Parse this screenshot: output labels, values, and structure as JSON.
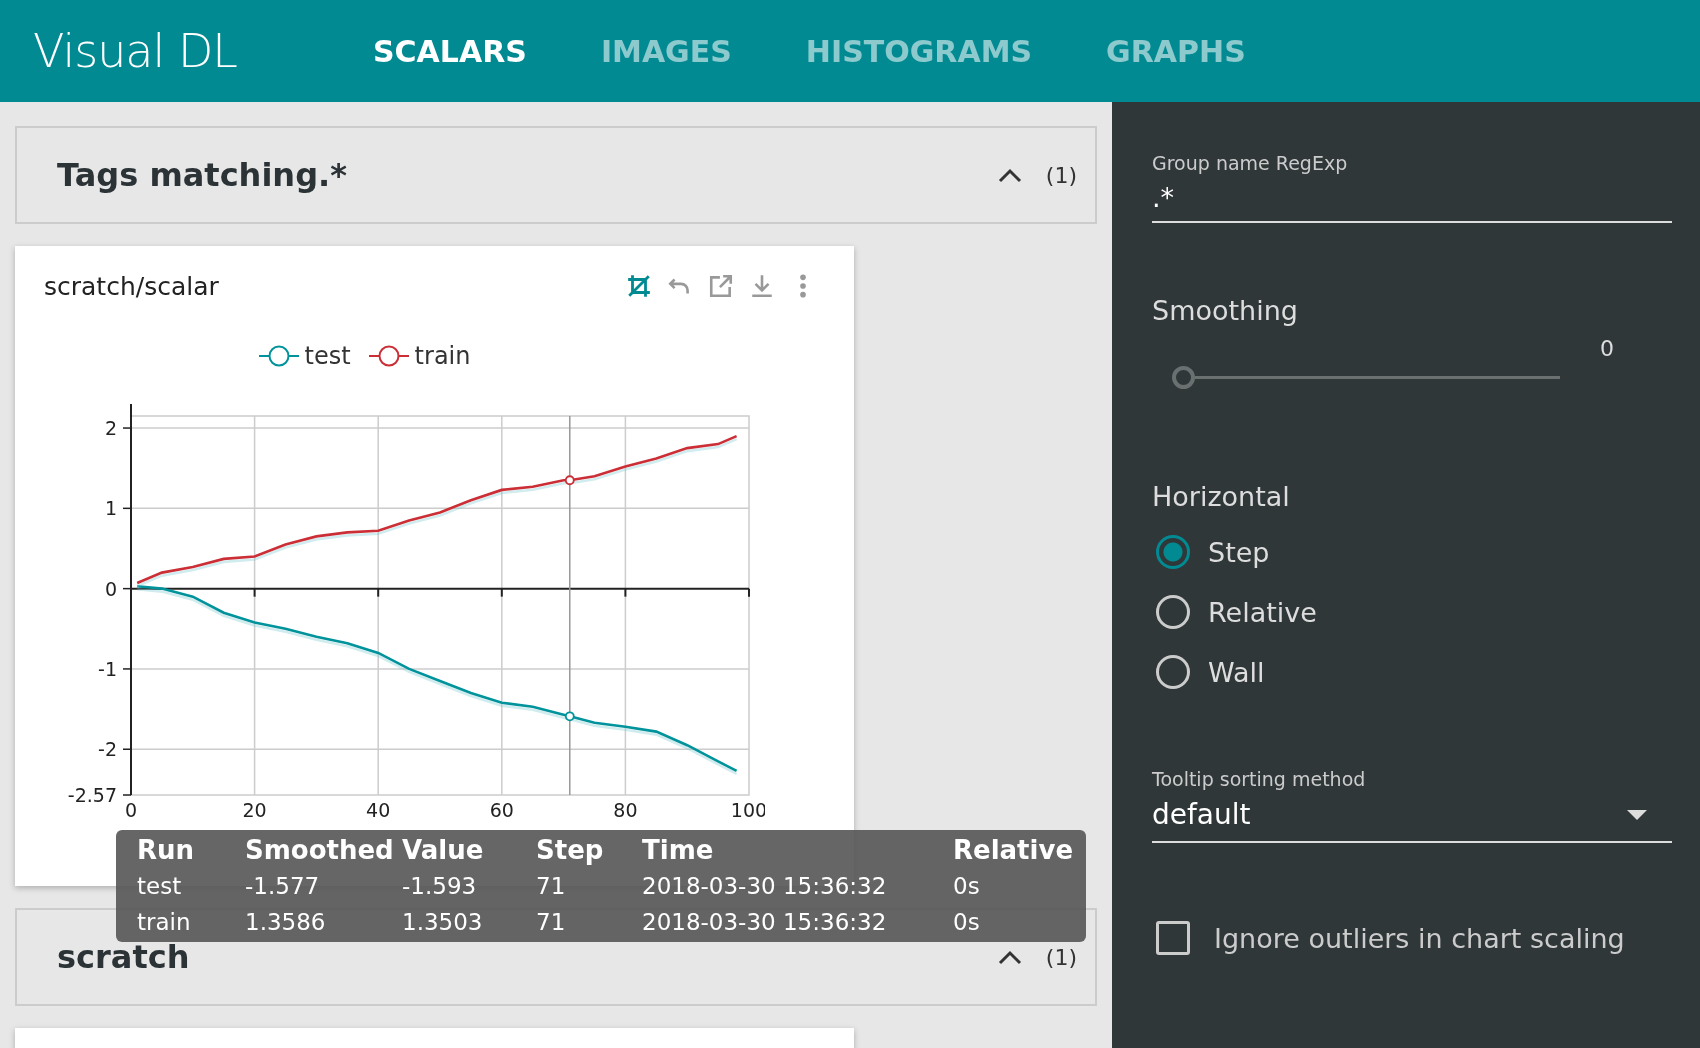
{
  "header": {
    "logo": "Visual DL",
    "tabs": [
      {
        "label": "SCALARS",
        "selected": true
      },
      {
        "label": "IMAGES",
        "selected": false
      },
      {
        "label": "HISTOGRAMS",
        "selected": false
      },
      {
        "label": "GRAPHS",
        "selected": false
      }
    ]
  },
  "groups": [
    {
      "title": "Tags matching.*",
      "expanded": true,
      "count": "(1)",
      "cards": [
        {
          "kind": "chart",
          "title": "scratch/scalar",
          "toolbar": [
            {
              "kind": "crop",
              "selected": true
            },
            {
              "kind": "undo",
              "selected": false
            },
            {
              "kind": "expand",
              "selected": false
            },
            {
              "kind": "download",
              "selected": false
            },
            {
              "kind": "more",
              "selected": false
            }
          ],
          "chart_data": {
            "type": "line",
            "x": [
              1,
              5,
              10,
              15,
              20,
              25,
              30,
              35,
              40,
              45,
              50,
              55,
              60,
              65,
              70,
              71,
              75,
              80,
              85,
              90,
              95,
              98
            ],
            "series": [
              {
                "name": "test",
                "color": "#00939c",
                "values": [
                  0.03,
                  0.0,
                  -0.1,
                  -0.3,
                  -0.42,
                  -0.5,
                  -0.6,
                  -0.68,
                  -0.8,
                  -1.0,
                  -1.15,
                  -1.3,
                  -1.42,
                  -1.47,
                  -1.57,
                  -1.59,
                  -1.67,
                  -1.72,
                  -1.78,
                  -1.95,
                  -2.15,
                  -2.27
                ]
              },
              {
                "name": "train",
                "color": "#cc2e36",
                "values": [
                  0.07,
                  0.2,
                  0.27,
                  0.37,
                  0.4,
                  0.55,
                  0.65,
                  0.7,
                  0.72,
                  0.85,
                  0.95,
                  1.1,
                  1.23,
                  1.27,
                  1.35,
                  1.35,
                  1.4,
                  1.52,
                  1.62,
                  1.75,
                  1.8,
                  1.9
                ]
              }
            ],
            "xlim": [
              0,
              100
            ],
            "ylim": [
              -2.57,
              2.15
            ],
            "xticks": [
              0,
              20,
              40,
              60,
              80,
              100
            ],
            "yticks": [
              -2.57,
              -2,
              -1,
              0,
              1,
              2
            ],
            "grid": true,
            "legend": "top",
            "ref_lines": [
              {
                "axis": "x",
                "value": 71
              }
            ]
          }
        }
      ]
    },
    {
      "title": "scratch",
      "expanded": true,
      "count": "(1)",
      "cards": [
        {
          "kind": "cut_off"
        }
      ]
    }
  ],
  "tooltip": {
    "columns": [
      "Run",
      "Smoothed",
      "Value",
      "Step",
      "Time",
      "Relative"
    ],
    "rows": [
      [
        "test",
        "-1.577",
        "-1.593",
        "71",
        "2018-03-30 15:36:32",
        "0s"
      ],
      [
        "train",
        "1.3586",
        "1.3503",
        "71",
        "2018-03-30 15:36:32",
        "0s"
      ]
    ]
  },
  "settings": {
    "regexp": {
      "label": "Group name RegExp",
      "value": ".*"
    },
    "smoothing": {
      "label": "Smoothing",
      "reading": "0",
      "level": 0
    },
    "horizontal": {
      "label": "Horizontal",
      "options": [
        {
          "label": "Step",
          "selected": true
        },
        {
          "label": "Relative",
          "selected": false
        },
        {
          "label": "Wall",
          "selected": false
        }
      ]
    },
    "sorting": {
      "label": "Tooltip sorting method",
      "value": "default"
    },
    "outliers": {
      "label": "Ignore outliers in chart scaling",
      "checked": false
    }
  }
}
